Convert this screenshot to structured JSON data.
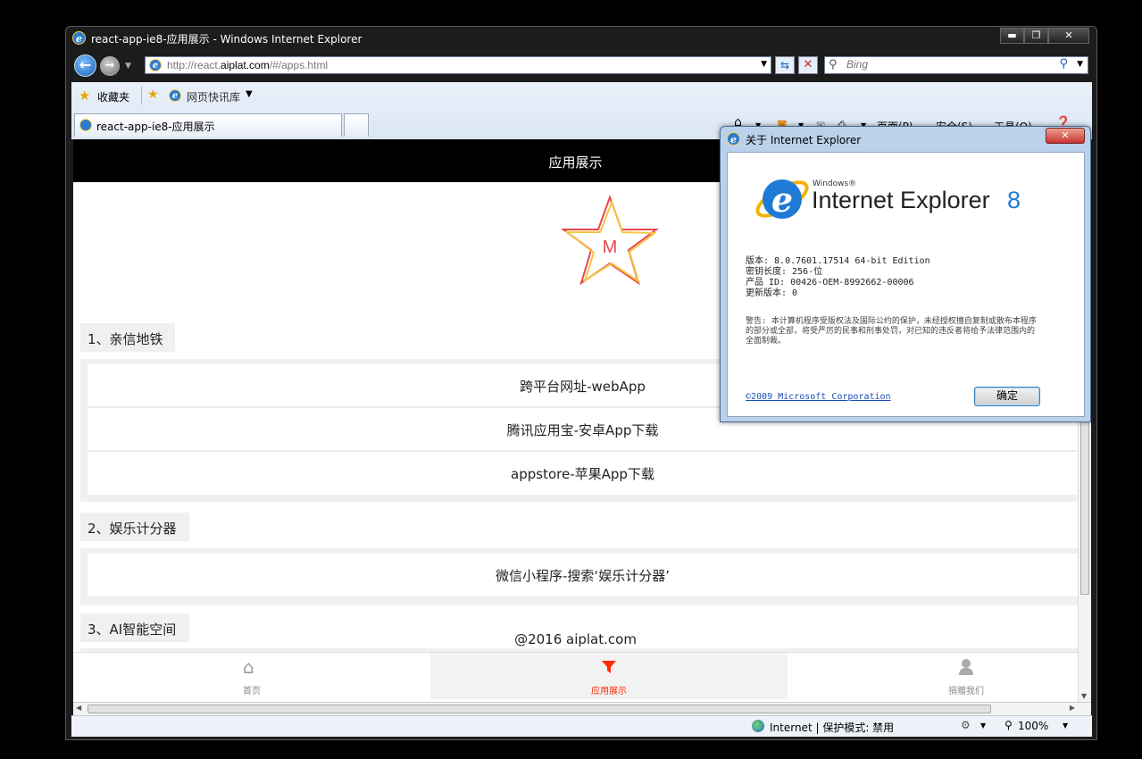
{
  "window": {
    "title": "react-app-ie8-应用展示 - Windows Internet Explorer",
    "controls": [
      "▬",
      "❐",
      "✕"
    ]
  },
  "nav": {
    "url_prefix": "http://react.",
    "url_domain": "aiplat.com",
    "url_suffix": "/#/apps.html",
    "search_placeholder": "Bing"
  },
  "favorites_bar": {
    "favorites_label": "收藏夹",
    "feed_label": "网页快讯库"
  },
  "tabs": [
    {
      "label": "react-app-ie8-应用展示"
    }
  ],
  "command_bar": {
    "page": "页面(P)",
    "safety": "安全(S)",
    "tools": "工具(O)"
  },
  "page": {
    "header_title": "应用展示",
    "logo_letter": "M",
    "sections": [
      {
        "title": "1、亲信地铁",
        "items": [
          "跨平台网址-webApp",
          "腾讯应用宝-安卓App下载",
          "appstore-苹果App下载"
        ]
      },
      {
        "title": "2、娱乐计分器",
        "items": [
          "微信小程序-搜索‘娱乐计分器’"
        ]
      },
      {
        "title": "3、AI智能空间",
        "items": []
      }
    ],
    "footer": "@2016 aiplat.com",
    "tabbar": [
      {
        "label": "首页",
        "icon": "home-icon"
      },
      {
        "label": "应用展示",
        "icon": "filter-icon"
      },
      {
        "label": "捐赠我们",
        "icon": "user-icon"
      }
    ],
    "accent_color": "#ff2a00"
  },
  "status_bar": {
    "zone": "Internet | 保护模式: 禁用",
    "zoom": "100%"
  },
  "dialog": {
    "title": "关于 Internet Explorer",
    "product_small": "Windows®",
    "product": "Internet Explorer",
    "version_num": "8",
    "version": "版本: 8.0.7601.17514  64-bit Edition",
    "cipher": "密钥长度: 256-位",
    "product_id": "产品 ID: 00426-OEM-8992662-00006",
    "update": "更新版本: 0",
    "warning": "警告: 本计算机程序受版权法及国际公约的保护，未经授权擅自复制或散布本程序的部分或全部，将受严厉的民事和刑事处罚，对已知的违反者将给予法律范围内的全面制裁。",
    "copyright_link": "©2009 Microsoft Corporation",
    "ok_label": "确定"
  }
}
